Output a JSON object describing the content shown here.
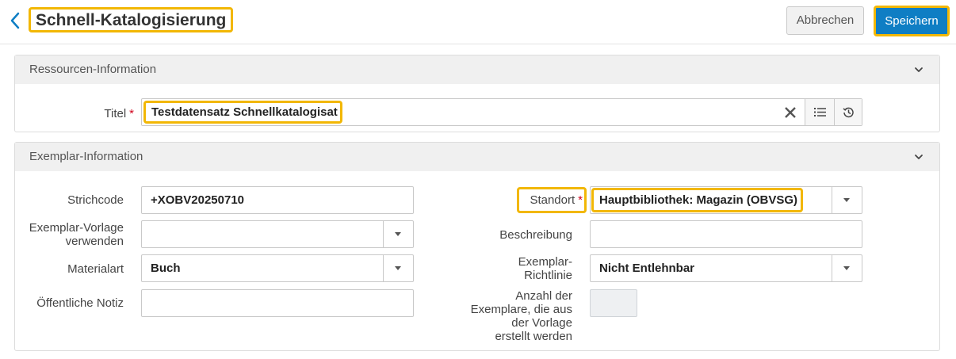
{
  "header": {
    "title": "Schnell-Katalogisierung",
    "cancel_label": "Abbrechen",
    "save_label": "Speichern"
  },
  "resource_section": {
    "title": "Ressourcen-Information",
    "titel_label": "Titel",
    "required_mark": "*",
    "titel_value": "Testdatensatz Schnellkatalogisat"
  },
  "item_section": {
    "title": "Exemplar-Information",
    "required_mark": "*",
    "barcode_label": "Strichcode",
    "barcode_value": "+XOBV20250710",
    "template_label_1": "Exemplar-Vorlage",
    "template_label_2": "verwenden",
    "template_value": "",
    "material_label": "Materialart",
    "material_value": "Buch",
    "public_note_label": "Öffentliche Notiz",
    "public_note_value": "",
    "location_label": "Standort",
    "location_value": "Hauptbibliothek: Magazin (OBVSG)",
    "description_label": "Beschreibung",
    "description_value": "",
    "policy_label_1": "Exemplar-",
    "policy_label_2": "Richtlinie",
    "policy_value": "Nicht Entlehnbar",
    "count_label_1": "Anzahl der",
    "count_label_2": "Exemplare, die aus",
    "count_label_3": "der Vorlage",
    "count_label_4": "erstellt werden",
    "count_value": ""
  },
  "icons": {
    "back": "chevron-left-icon",
    "clear": "close-icon",
    "list": "list-icon",
    "history": "history-icon",
    "collapse": "chevron-down-icon",
    "dropdown": "caret-down-icon"
  },
  "colors": {
    "accent": "#0f7ec4",
    "highlight": "#f2b705",
    "required": "#d0021b",
    "panel_header": "#f0f0f0"
  }
}
